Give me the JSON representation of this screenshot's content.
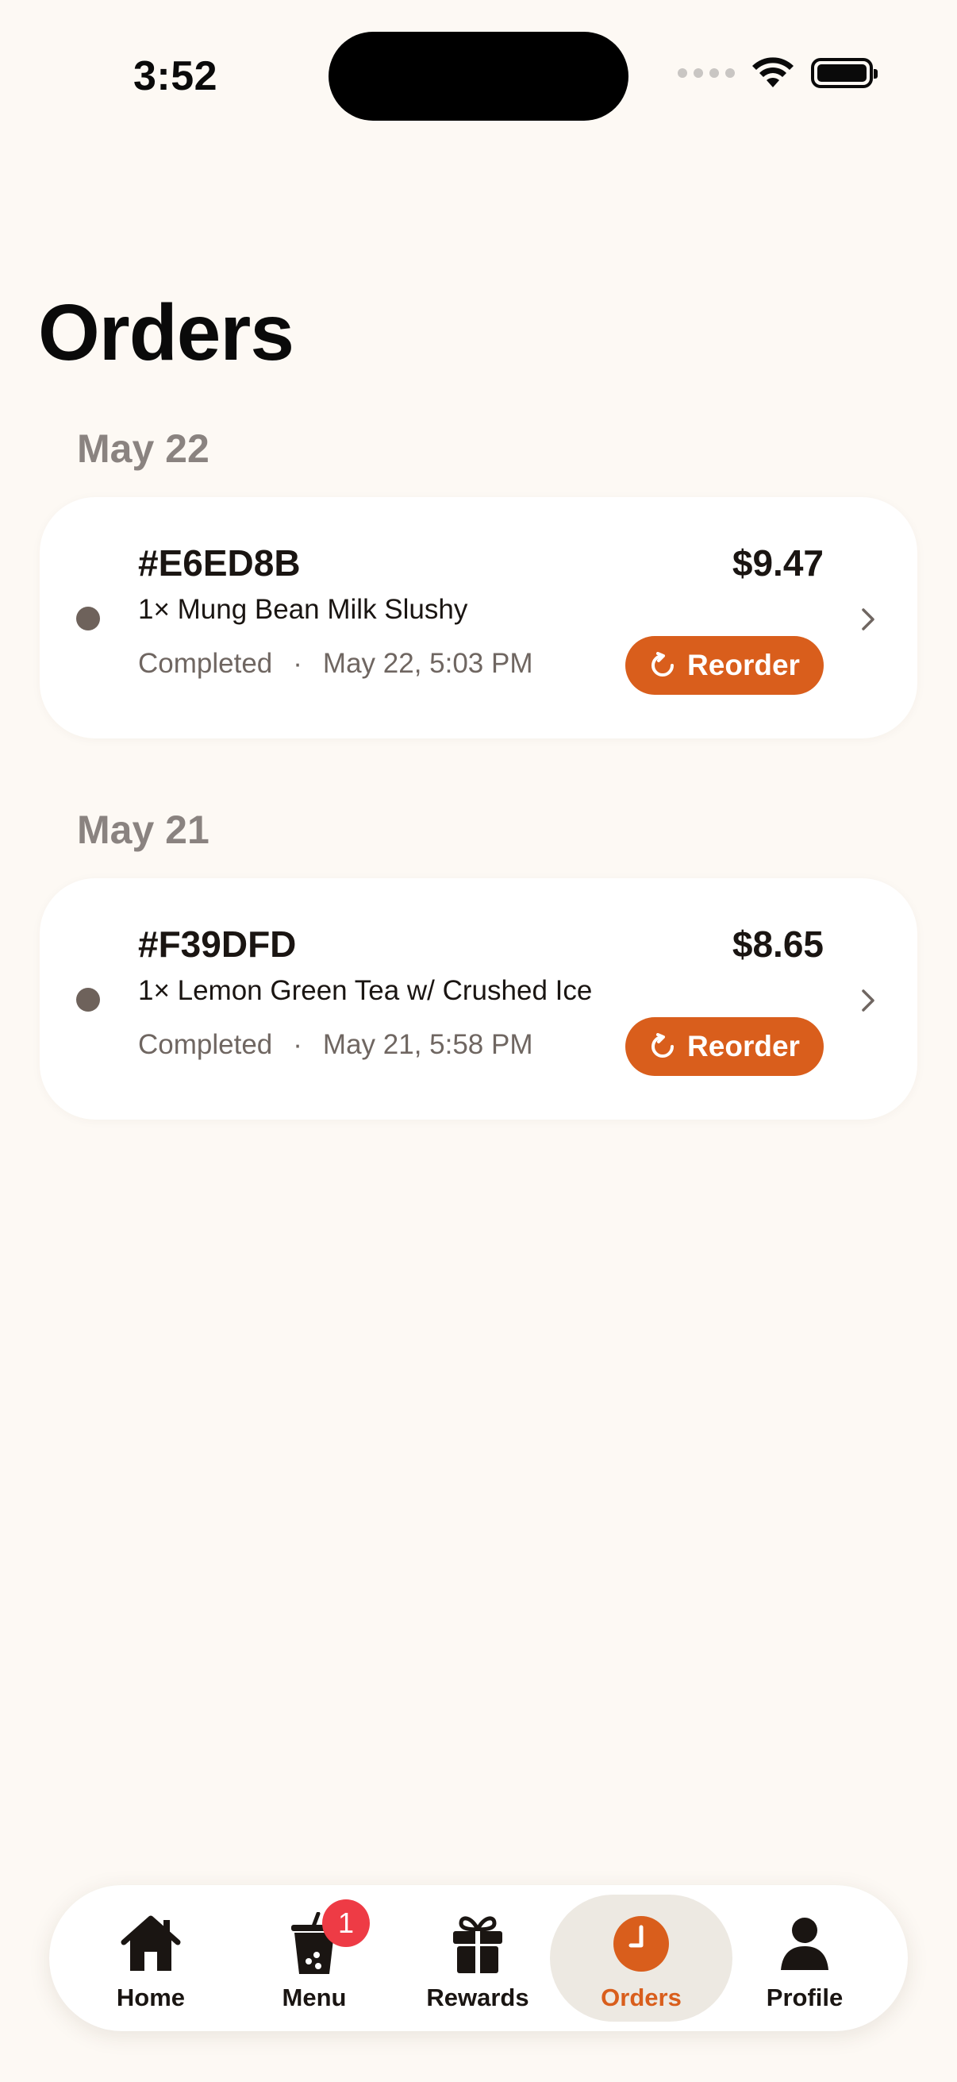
{
  "status_bar": {
    "time": "3:52"
  },
  "page": {
    "title": "Orders"
  },
  "sections": [
    {
      "date": "May 22",
      "order": {
        "id": "#E6ED8B",
        "price": "$9.47",
        "items": "1× Mung Bean Milk Slushy",
        "status": "Completed",
        "separator": "·",
        "timestamp": "May 22, 5:03 PM",
        "reorder_label": "Reorder"
      }
    },
    {
      "date": "May 21",
      "order": {
        "id": "#F39DFD",
        "price": "$8.65",
        "items": "1× Lemon Green Tea w/ Crushed Ice",
        "status": "Completed",
        "separator": "·",
        "timestamp": "May 21, 5:58 PM",
        "reorder_label": "Reorder"
      }
    }
  ],
  "tab_bar": {
    "tabs": [
      {
        "label": "Home",
        "icon": "home-icon"
      },
      {
        "label": "Menu",
        "icon": "cup-icon",
        "badge": "1"
      },
      {
        "label": "Rewards",
        "icon": "gift-icon"
      },
      {
        "label": "Orders",
        "icon": "clock-icon",
        "active": true
      },
      {
        "label": "Profile",
        "icon": "person-icon"
      }
    ]
  },
  "colors": {
    "background": "#FDF9F4",
    "accent": "#D95E1C",
    "badge": "#EE3B45",
    "status_dot": "#6E625B"
  }
}
